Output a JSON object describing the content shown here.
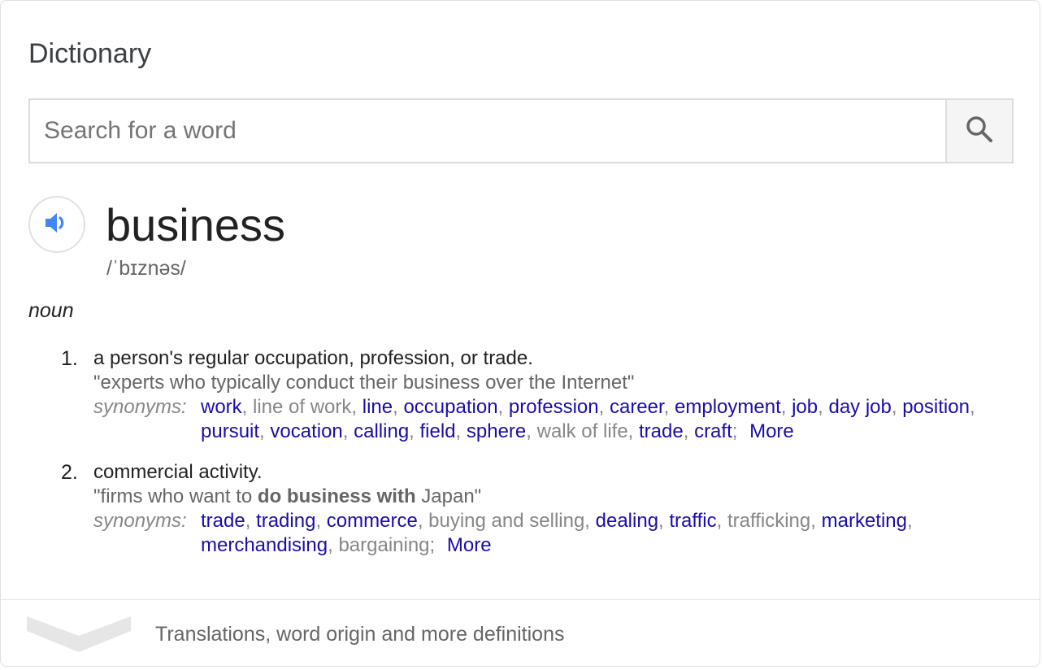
{
  "header": {
    "title": "Dictionary"
  },
  "search": {
    "placeholder": "Search for a word",
    "icon": "search-icon"
  },
  "entry": {
    "word": "business",
    "phonetic": "/ˈbɪznəs/",
    "part_of_speech": "noun",
    "audio_icon": "speaker-icon"
  },
  "senses": [
    {
      "number": "1.",
      "definition": "a person's regular occupation, profession, or trade.",
      "example": "\"experts who typically conduct their business over the Internet\"",
      "synonyms_label": "synonyms:",
      "synonyms": [
        {
          "text": "work",
          "link": true
        },
        {
          "text": "line of work",
          "link": false
        },
        {
          "text": "line",
          "link": true
        },
        {
          "text": "occupation",
          "link": true
        },
        {
          "text": "profession",
          "link": true
        },
        {
          "text": "career",
          "link": true
        },
        {
          "text": "employment",
          "link": true
        },
        {
          "text": "job",
          "link": true
        },
        {
          "text": "day job",
          "link": true
        },
        {
          "text": "position",
          "link": true
        },
        {
          "text": "pursuit",
          "link": true
        },
        {
          "text": "vocation",
          "link": true
        },
        {
          "text": "calling",
          "link": true
        },
        {
          "text": "field",
          "link": true
        },
        {
          "text": "sphere",
          "link": true
        },
        {
          "text": "walk of life",
          "link": false
        },
        {
          "text": "trade",
          "link": true
        },
        {
          "text": "craft",
          "link": true
        }
      ],
      "more_label": "More"
    },
    {
      "number": "2.",
      "definition": "commercial activity.",
      "example_before": "\"firms who want to ",
      "example_bold": "do business with",
      "example_after": " Japan\"",
      "synonyms_label": "synonyms:",
      "synonyms": [
        {
          "text": "trade",
          "link": true
        },
        {
          "text": "trading",
          "link": true
        },
        {
          "text": "commerce",
          "link": true
        },
        {
          "text": "buying and selling",
          "link": false
        },
        {
          "text": "dealing",
          "link": true
        },
        {
          "text": "traffic",
          "link": true
        },
        {
          "text": "trafficking",
          "link": false
        },
        {
          "text": "marketing",
          "link": true
        },
        {
          "text": "merchandising",
          "link": true
        },
        {
          "text": "bargaining",
          "link": false
        }
      ],
      "more_label": "More"
    }
  ],
  "footer": {
    "label": "Translations, word origin and more definitions",
    "icon": "chevron-down-icon"
  },
  "colors": {
    "link": "#1a0dab",
    "muted": "#878787",
    "text": "#222222",
    "speaker": "#4285f4"
  }
}
